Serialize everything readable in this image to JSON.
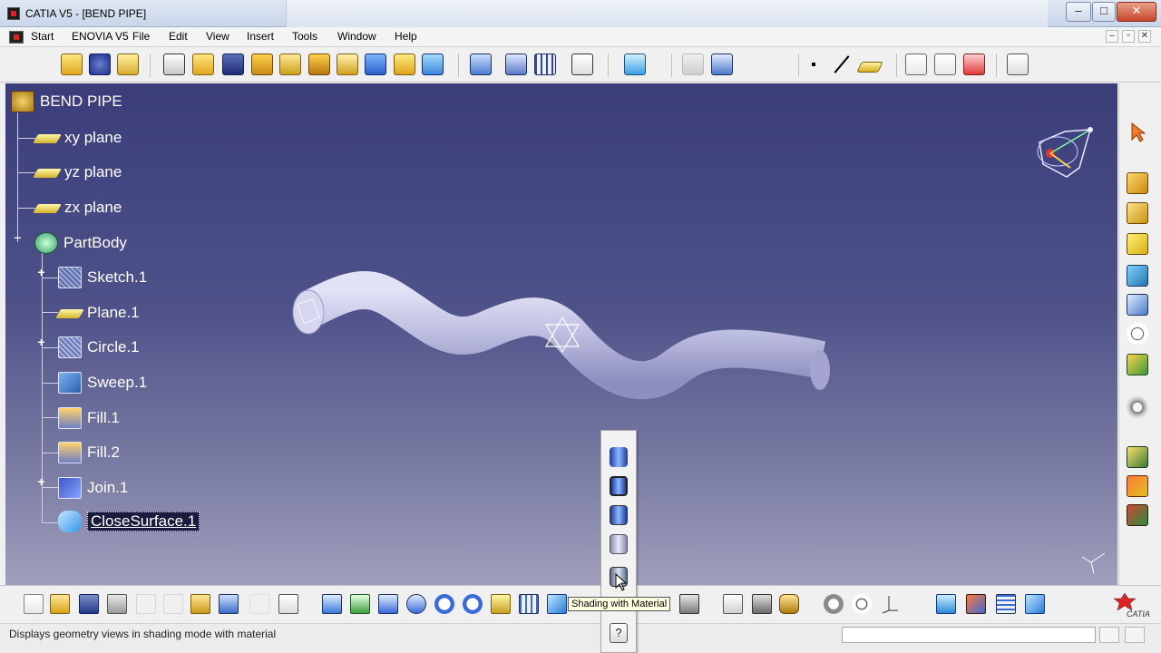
{
  "window": {
    "title": "CATIA V5 - [BEND PIPE]",
    "minimize": "–",
    "maximize": "□",
    "close": "✕"
  },
  "menu": {
    "items": [
      "Start",
      "ENOVIA V5",
      "File",
      "Edit",
      "View",
      "Insert",
      "Tools",
      "Window",
      "Help"
    ],
    "mdi_minimize": "–",
    "mdi_restore": "▫",
    "mdi_close": "✕"
  },
  "tree": {
    "root": "BEND PIPE",
    "items": [
      {
        "label": "xy plane",
        "icon": "plane-icon"
      },
      {
        "label": "yz plane",
        "icon": "plane-icon"
      },
      {
        "label": "zx plane",
        "icon": "plane-icon"
      },
      {
        "label": "PartBody",
        "icon": "gear-body-icon"
      },
      {
        "label": "Sketch.1",
        "icon": "sketch-icon"
      },
      {
        "label": "Plane.1",
        "icon": "plane-icon"
      },
      {
        "label": "Circle.1",
        "icon": "circle-icon"
      },
      {
        "label": "Sweep.1",
        "icon": "sweep-icon"
      },
      {
        "label": "Fill.1",
        "icon": "fill-icon"
      },
      {
        "label": "Fill.2",
        "icon": "fill-icon"
      },
      {
        "label": "Join.1",
        "icon": "join-icon"
      },
      {
        "label": "CloseSurface.1",
        "icon": "close-surface-icon"
      }
    ]
  },
  "flyout": {
    "tooltip": "Shading with Material",
    "help": "?"
  },
  "status": {
    "message": "Displays geometry views in shading mode with material",
    "command_value": ""
  },
  "brand": {
    "logo_text": "CATIA"
  },
  "colors": {
    "viewport_top": "#3a3d7a",
    "viewport_bottom": "#a09fbd",
    "pipe": "#c9c9ea",
    "selected_bg": "#1b1b3f"
  }
}
